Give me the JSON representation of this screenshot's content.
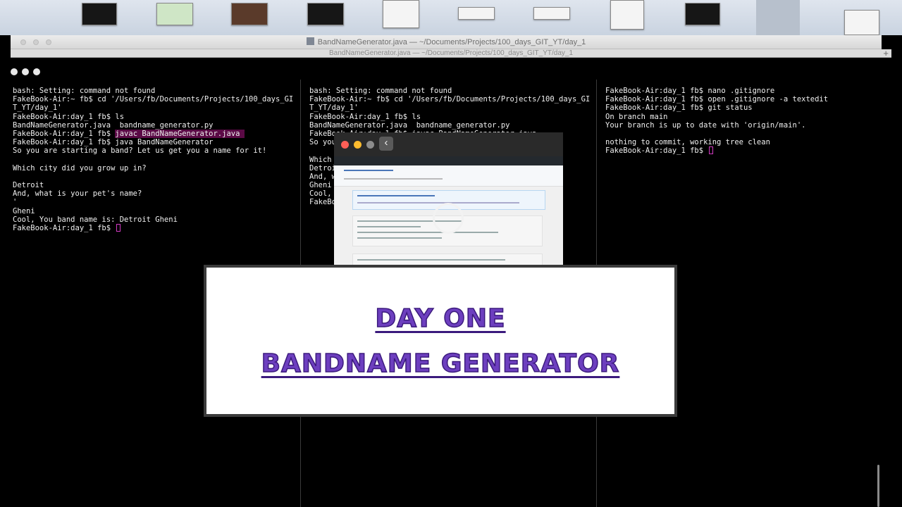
{
  "window": {
    "title": "BandNameGenerator.java — ~/Documents/Projects/100_days_GIT_YT/day_1",
    "title_secondary": "BandNameGenerator.java — ~/Documents/Projects/100_days_GIT_YT/day_1",
    "new_tab_icon": "plus-icon"
  },
  "panes": [
    {
      "lines": [
        "bash: Setting: command not found",
        "FakeBook-Air:~ fb$ cd '/Users/fb/Documents/Projects/100_days_GI",
        "T_YT/day_1'",
        "FakeBook-Air:day_1 fb$ ls",
        "BandNameGenerator.java  bandname_generator.py",
        "FakeBook-Air:day_1 fb$ ",
        "FakeBook-Air:day_1 fb$ java BandNameGenerator",
        "So you are starting a band? Let us get you a name for it!",
        "",
        "Which city did you grow up in?",
        "",
        "Detroit",
        "And, what is your pet's name?",
        "'",
        "Gheni",
        "Cool, You band name is: Detroit Gheni",
        "FakeBook-Air:day_1 fb$ "
      ],
      "highlighted_command": "javac BandNameGenerator.java "
    },
    {
      "lines": [
        "bash: Setting: command not found",
        "FakeBook-Air:~ fb$ cd '/Users/fb/Documents/Projects/100_days_GI",
        "T_YT/day_1'",
        "FakeBook-Air:day_1 fb$ ls",
        "BandNameGenerator.java  bandname_generator.py",
        "FakeBook-Air:day_1 fb$ javac BandNameGenerator.java",
        "So you",
        "",
        "Which",
        "Detroi",
        "And, w",
        "Gheni",
        "Cool,",
        "FakeBo"
      ]
    },
    {
      "lines": [
        "FakeBook-Air:day_1 fb$ nano .gitignore",
        "FakeBook-Air:day_1 fb$ open .gitignore -a textedit",
        "FakeBook-Air:day_1 fb$ git status",
        "On branch main",
        "Your branch is up to date with 'origin/main'.",
        "",
        "nothing to commit, working tree clean",
        "FakeBook-Air:day_1 fb$ "
      ]
    }
  ],
  "preview": {
    "back_icon": "chevron-left-icon",
    "back_glyph": "‹",
    "traffic_colors": [
      "#ff5f57",
      "#febc2e",
      "#8c8c8c"
    ],
    "loading_icon": "spinner-icon"
  },
  "title_card": {
    "line1": "Day One",
    "line2": "Bandname Generator"
  },
  "colors": {
    "title_fill": "#6d3fbf",
    "title_outline": "#3b1a7d",
    "cursor": "#d23ac2",
    "highlight": "#5b0a46"
  }
}
